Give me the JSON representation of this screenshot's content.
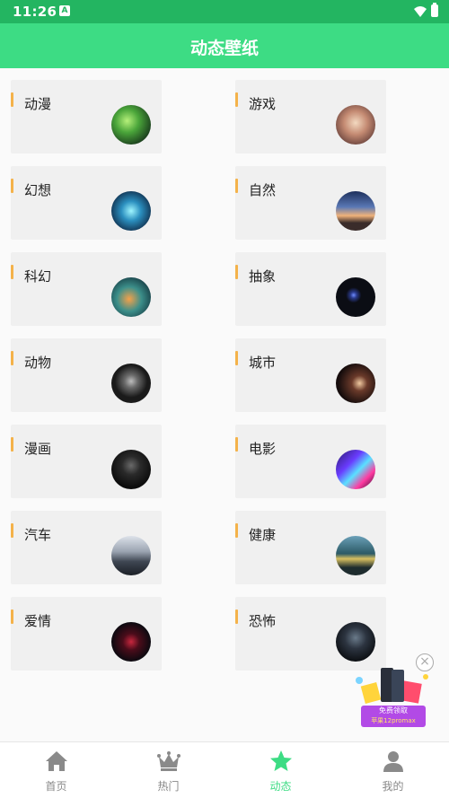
{
  "status_bar": {
    "time": "11:26",
    "notification_letter": "A"
  },
  "title": "动态壁纸",
  "categories": [
    {
      "label": "动漫",
      "thumb": "green-anime"
    },
    {
      "label": "游戏",
      "thumb": "hall"
    },
    {
      "label": "幻想",
      "thumb": "blue-fantasy"
    },
    {
      "label": "自然",
      "thumb": "sunset-sky"
    },
    {
      "label": "科幻",
      "thumb": "scifi-ship"
    },
    {
      "label": "抽象",
      "thumb": "dark-orb"
    },
    {
      "label": "动物",
      "thumb": "cat"
    },
    {
      "label": "城市",
      "thumb": "city-night"
    },
    {
      "label": "漫画",
      "thumb": "dark-figure"
    },
    {
      "label": "电影",
      "thumb": "neon-galaxy"
    },
    {
      "label": "汽车",
      "thumb": "car"
    },
    {
      "label": "健康",
      "thumb": "building"
    },
    {
      "label": "爱情",
      "thumb": "red-heart"
    },
    {
      "label": "恐怖",
      "thumb": "dark-horror"
    }
  ],
  "ad": {
    "line1": "免费领取",
    "line2": "苹果12promax",
    "close": "×"
  },
  "tabs": [
    {
      "label": "首页",
      "icon": "home-icon",
      "active": false
    },
    {
      "label": "热门",
      "icon": "crown-icon",
      "active": false
    },
    {
      "label": "动态",
      "icon": "star-icon",
      "active": true
    },
    {
      "label": "我的",
      "icon": "person-icon",
      "active": false
    }
  ],
  "colors": {
    "primary": "#3ddc84",
    "status_bar": "#23b561",
    "accent": "#f4b24a",
    "inactive": "#888888"
  }
}
